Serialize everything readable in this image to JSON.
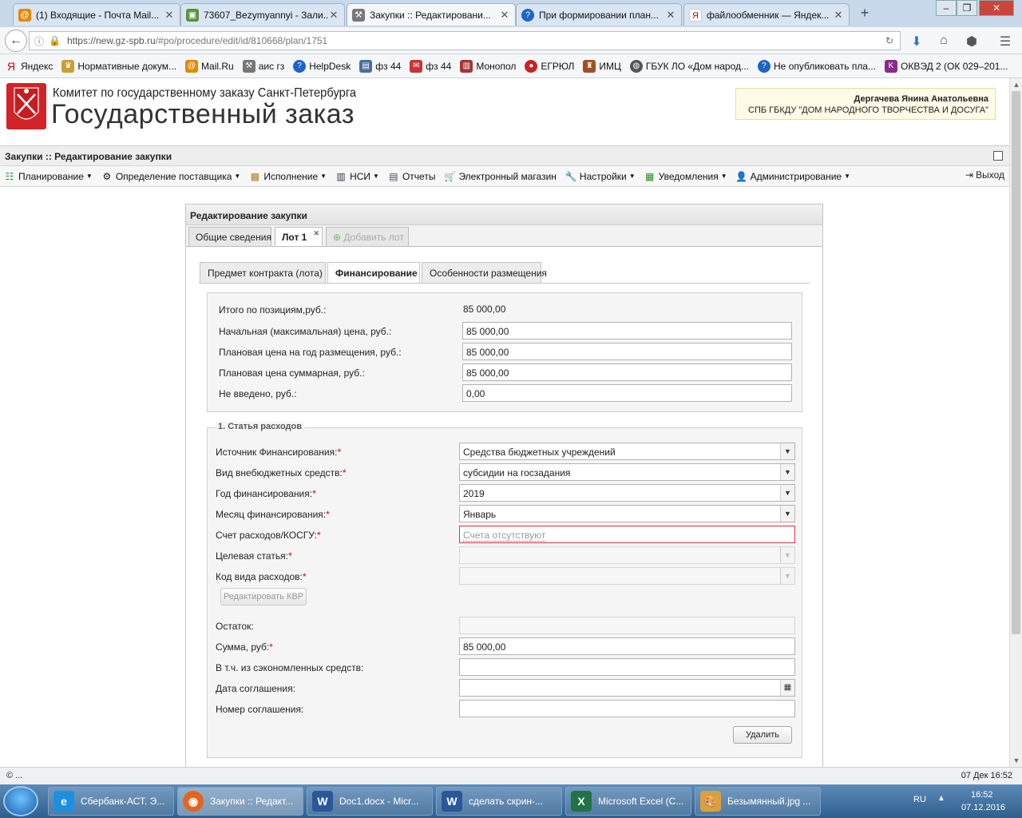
{
  "browser": {
    "tabs": [
      {
        "title": "(1) Входящие - Почта Mail...",
        "active": false
      },
      {
        "title": "73607_Bezymyannyi - Зали...",
        "active": false
      },
      {
        "title": "Закупки :: Редактировани...",
        "active": true
      },
      {
        "title": "При формировании план...",
        "active": false
      },
      {
        "title": "файлообменник — Яндек...",
        "active": false
      }
    ],
    "url_host": "https://new.gz-spb.ru",
    "url_path": "/#po/procedure/edit/id/810668/plan/1751",
    "bookmarks": [
      "Яндекс",
      "Нормативные докум...",
      "Mail.Ru",
      "аис гз",
      "HelpDesk",
      "фз 44",
      "фз 44",
      "Монопол",
      "ЕГРЮЛ",
      "ИМЦ",
      "ГБУК ЛО «Дом народ...",
      "Не опубликовать пла...",
      "ОКВЭД 2 (ОК 029–201..."
    ]
  },
  "header": {
    "org": "Комитет по государственному заказу Санкт-Петербурга",
    "system": "Государственный заказ",
    "user_name": "Дергачева Янина Анатольевна",
    "user_org": "СПБ ГБКДУ \"ДОМ НАРОДНОГО ТВОРЧЕСТВА И ДОСУГА\""
  },
  "app": {
    "title": "Закупки :: Редактирование закупки",
    "menu": [
      "Планирование",
      "Определение поставщика",
      "Исполнение",
      "НСИ",
      "Отчеты",
      "Электронный магазин",
      "Настройки",
      "Уведомления",
      "Администрирование"
    ],
    "logout": "Выход"
  },
  "panel": {
    "title": "Редактирование закупки",
    "tabs": [
      "Общие сведения",
      "Лот 1",
      "Добавить лот"
    ],
    "subtabs": [
      "Предмет контракта (лота)",
      "Финансирование",
      "Особенности размещения"
    ],
    "totals": {
      "total_label": "Итого по позициям,руб.:",
      "total_value": "85 000,00",
      "nmc_label": "Начальная (максимальная) цена, руб.:",
      "nmc_value": "85 000,00",
      "plan_year_label": "Плановая цена на год размещения, руб.:",
      "plan_year_value": "85 000,00",
      "plan_sum_label": "Плановая цена суммарная, руб.:",
      "plan_sum_value": "85 000,00",
      "not_entered_label": "Не введено, руб.:",
      "not_entered_value": "0,00"
    },
    "expense": {
      "legend": "1. Статья расходов",
      "source_label": "Источник Финансирования:",
      "source_value": "Средства бюджетных учреждений",
      "extra_label": "Вид внебюджетных средств:",
      "extra_value": "субсидии на госзадания",
      "year_label": "Год финансирования:",
      "year_value": "2019",
      "month_label": "Месяц финансирования:",
      "month_value": "Январь",
      "account_label": "Счет расходов/КОСГУ:",
      "account_placeholder": "Счета отсутствуют",
      "target_label": "Целевая статья:",
      "kvr_label": "Код вида расходов:",
      "edit_kvr": "Редактировать КВР",
      "rest_label": "Остаток:",
      "sum_label": "Сумма, руб:",
      "sum_value": "85 000,00",
      "saved_label": "В т.ч. из сэкономленных средств:",
      "date_label": "Дата соглашения:",
      "number_label": "Номер соглашения:",
      "delete": "Удалить",
      "required_mark": "*"
    }
  },
  "status": {
    "left": "© ...",
    "right": "07 Дек 16:52"
  },
  "taskbar": {
    "items": [
      "Сбербанк-АСТ. Э...",
      "Закупки :: Редакт...",
      "Doc1.docx - Micr...",
      "сделать скрин-...",
      "Microsoft Excel (С...",
      "Безымянный.jpg ..."
    ],
    "lang": "RU",
    "time": "16:52",
    "date": "07.12.2016"
  },
  "colors": {
    "accent_red": "#d12328",
    "required": "#dd0000",
    "error_border": "#dd3333"
  }
}
